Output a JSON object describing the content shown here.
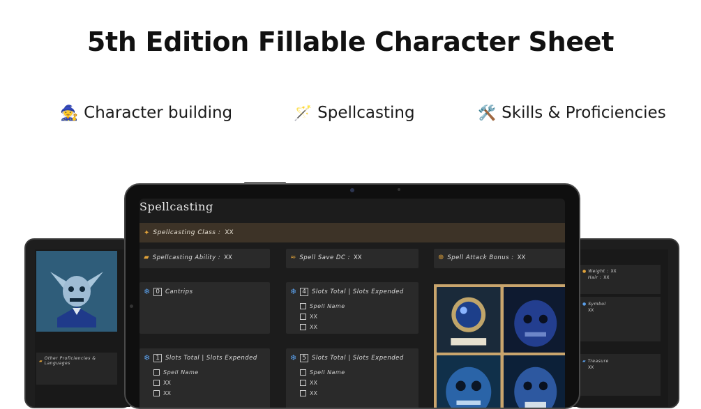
{
  "page": {
    "title": "5th Edition Fillable Character Sheet",
    "features": [
      {
        "icon": "wizard-icon",
        "emoji": "🧙",
        "label": "Character building"
      },
      {
        "icon": "wand-icon",
        "emoji": "🪄",
        "label": "Spellcasting"
      },
      {
        "icon": "tools-icon",
        "emoji": "🛠️",
        "label": "Skills & Proficiencies"
      }
    ]
  },
  "spellcasting": {
    "title": "Spellcasting",
    "class_label": "Spellcasting Class :",
    "class_value": "XX",
    "ability_label": "Spellcasting Ability :",
    "ability_value": "XX",
    "save_label": "Spell Save DC :",
    "save_value": "XX",
    "attack_label": "Spell Attack Bonus :",
    "attack_value": "XX",
    "levels": [
      {
        "level": "0",
        "header": "Cantrips",
        "rows": []
      },
      {
        "level": "4",
        "header": "Slots Total | Slots Expended",
        "rows": [
          "Spell Name",
          "XX",
          "XX"
        ]
      },
      {
        "level": "1",
        "header": "Slots Total | Slots Expended",
        "rows": [
          "Spell Name",
          "XX",
          "XX"
        ]
      },
      {
        "level": "5",
        "header": "Slots Total | Slots Expended",
        "rows": [
          "Spell Name",
          "XX",
          "XX"
        ]
      }
    ]
  },
  "left_tablet": {
    "proficiencies_label": "Other Proficiencies & Languages"
  },
  "right_tablet": {
    "weight_label": "Weight :",
    "weight_value": "XX",
    "hair_label": "Hair :",
    "hair_value": "XX",
    "symbol_label": "Symbol",
    "symbol_value": "XX",
    "treasure_label": "Treasure",
    "treasure_value": "XX"
  },
  "colors": {
    "accent_gold": "#e0a23a",
    "accent_blue": "#5a9ee8",
    "class_bar": "#3d3327"
  }
}
